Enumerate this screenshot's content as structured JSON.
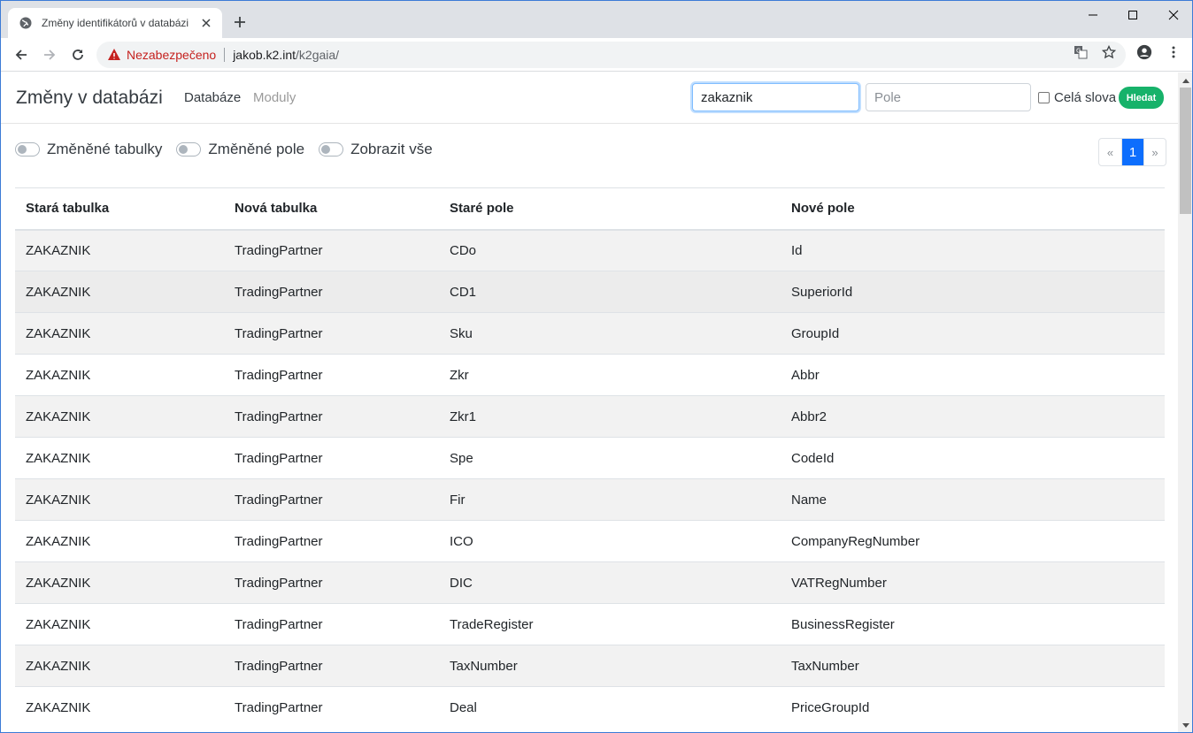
{
  "browser": {
    "tab_title": "Změny identifikátorů v databázi",
    "security_label": "Nezabezpečeno",
    "url_host": "jakob.k2.int",
    "url_path": "/k2gaia/",
    "icons": [
      "globe-icon",
      "close-icon",
      "plus-icon",
      "minimize-icon",
      "maximize-icon",
      "close-window-icon",
      "back-icon",
      "forward-icon",
      "reload-icon",
      "warning-icon",
      "translate-icon",
      "star-icon",
      "account-icon",
      "menu-icon"
    ]
  },
  "navbar": {
    "brand": "Změny v databázi",
    "links": [
      "Databáze",
      "Moduly"
    ],
    "search_value": "zakaznik",
    "field_placeholder": "Pole",
    "whole_words_label": "Celá slova",
    "search_button": "Hledat"
  },
  "filters": {
    "changed_tables": "Změněné tabulky",
    "changed_fields": "Změněné pole",
    "show_all": "Zobrazit vše"
  },
  "pagination": {
    "prev": "«",
    "current": "1",
    "next": "»"
  },
  "table": {
    "headers": [
      "Stará tabulka",
      "Nová tabulka",
      "Staré pole",
      "Nové pole"
    ],
    "rows": [
      [
        "ZAKAZNIK",
        "TradingPartner",
        "CDo",
        "Id"
      ],
      [
        "ZAKAZNIK",
        "TradingPartner",
        "CD1",
        "SuperiorId"
      ],
      [
        "ZAKAZNIK",
        "TradingPartner",
        "Sku",
        "GroupId"
      ],
      [
        "ZAKAZNIK",
        "TradingPartner",
        "Zkr",
        "Abbr"
      ],
      [
        "ZAKAZNIK",
        "TradingPartner",
        "Zkr1",
        "Abbr2"
      ],
      [
        "ZAKAZNIK",
        "TradingPartner",
        "Spe",
        "CodeId"
      ],
      [
        "ZAKAZNIK",
        "TradingPartner",
        "Fir",
        "Name"
      ],
      [
        "ZAKAZNIK",
        "TradingPartner",
        "ICO",
        "CompanyRegNumber"
      ],
      [
        "ZAKAZNIK",
        "TradingPartner",
        "DIC",
        "VATRegNumber"
      ],
      [
        "ZAKAZNIK",
        "TradingPartner",
        "TradeRegister",
        "BusinessRegister"
      ],
      [
        "ZAKAZNIK",
        "TradingPartner",
        "TaxNumber",
        "TaxNumber"
      ],
      [
        "ZAKAZNIK",
        "TradingPartner",
        "Deal",
        "PriceGroupId"
      ]
    ]
  },
  "colors": {
    "accent": "#17b26a",
    "active_page": "#0d6efd",
    "insecure": "#c5221f"
  }
}
